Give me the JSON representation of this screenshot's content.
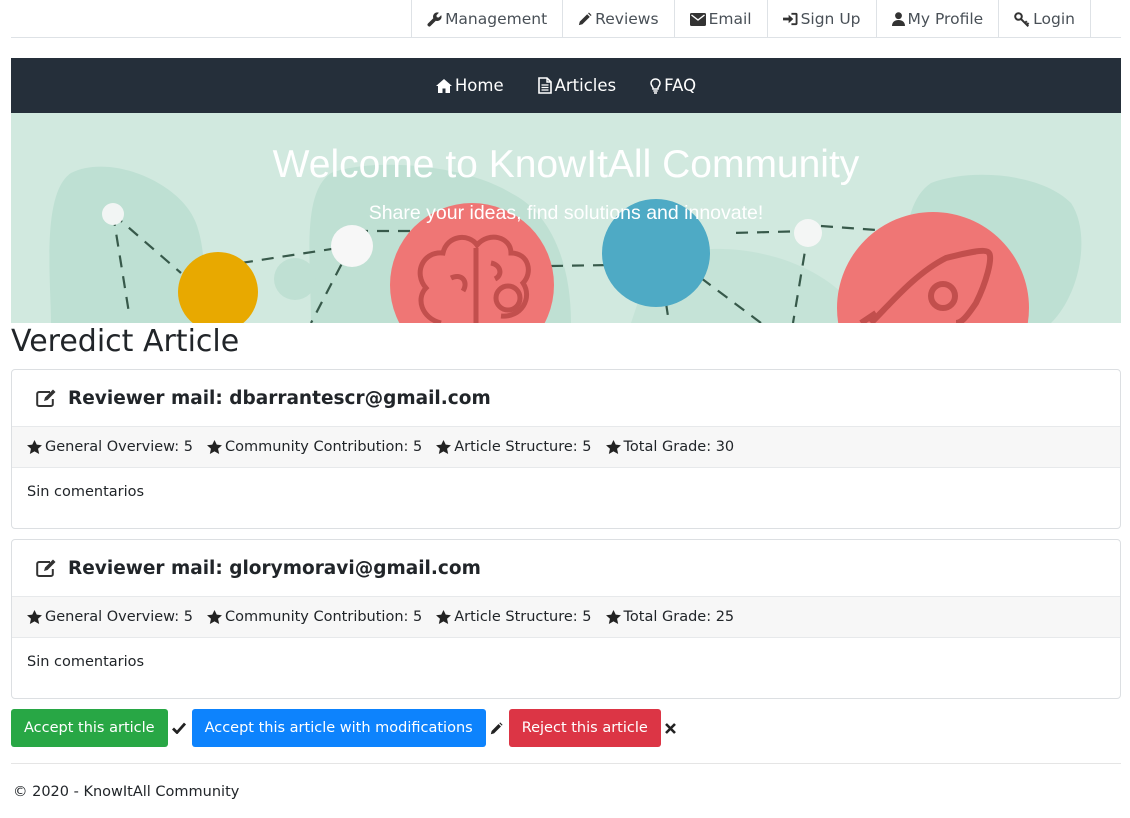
{
  "topnav": {
    "items": [
      {
        "label": "Management",
        "icon": "wrench-icon"
      },
      {
        "label": "Reviews",
        "icon": "pencil-icon"
      },
      {
        "label": "Email",
        "icon": "envelope-icon"
      },
      {
        "label": "Sign Up",
        "icon": "sign-in-icon"
      },
      {
        "label": "My Profile",
        "icon": "user-icon"
      },
      {
        "label": "Login",
        "icon": "key-icon"
      }
    ]
  },
  "mainnav": {
    "items": [
      {
        "label": "Home",
        "icon": "home-icon"
      },
      {
        "label": "Articles",
        "icon": "file-text-icon"
      },
      {
        "label": "FAQ",
        "icon": "lightbulb-icon"
      }
    ]
  },
  "hero": {
    "title": "Welcome to KnowItAll Community",
    "subtitle": "Share your ideas, find solutions and innovate!"
  },
  "page": {
    "title": "Veredict Article"
  },
  "reviews": [
    {
      "header": "Reviewer mail: dbarrantescr@gmail.com",
      "grades": [
        "General Overview: 5",
        "Community Contribution: 5",
        "Article Structure: 5",
        "Total Grade: 30"
      ],
      "comment": "Sin comentarios"
    },
    {
      "header": "Reviewer mail: glorymoravi@gmail.com",
      "grades": [
        "General Overview: 5",
        "Community Contribution: 5",
        "Article Structure: 5",
        "Total Grade: 25"
      ],
      "comment": "Sin comentarios"
    }
  ],
  "actions": {
    "accept_label": "Accept this article",
    "accept_mod_label": "Accept this article with modifications",
    "reject_label": "Reject this article"
  },
  "footer": {
    "text": "© 2020 - KnowItAll Community"
  },
  "colors": {
    "nav_dark": "#252f3a",
    "hero_bg": "#d1e9df",
    "success": "#28a745",
    "primary": "#0d83fd",
    "danger": "#dc3545"
  }
}
